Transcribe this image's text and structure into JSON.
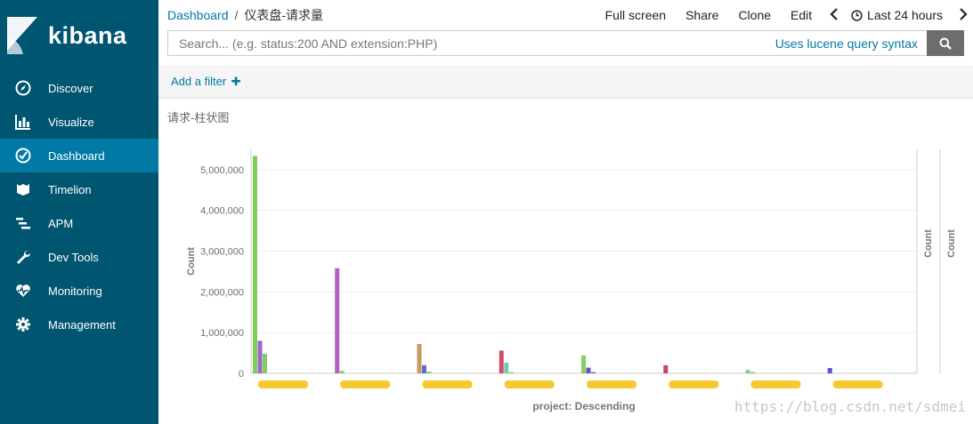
{
  "app": {
    "logo_text": "kibana"
  },
  "sidebar": {
    "items": [
      {
        "label": "Discover",
        "icon": "compass-icon"
      },
      {
        "label": "Visualize",
        "icon": "bar-chart-icon"
      },
      {
        "label": "Dashboard",
        "icon": "dashboard-icon",
        "active": true
      },
      {
        "label": "Timelion",
        "icon": "timelion-icon"
      },
      {
        "label": "APM",
        "icon": "apm-icon"
      },
      {
        "label": "Dev Tools",
        "icon": "wrench-icon"
      },
      {
        "label": "Monitoring",
        "icon": "heartbeat-icon"
      },
      {
        "label": "Management",
        "icon": "gear-icon"
      }
    ]
  },
  "header": {
    "breadcrumb_root": "Dashboard",
    "breadcrumb_sep": "/",
    "breadcrumb_current": "仪表盘-请求量",
    "actions": [
      "Full screen",
      "Share",
      "Clone",
      "Edit"
    ],
    "time_label": "Last 24 hours"
  },
  "search": {
    "placeholder": "Search... (e.g. status:200 AND extension:PHP)",
    "lucene_link": "Uses lucene query syntax"
  },
  "filters": {
    "add_label": "Add a filter"
  },
  "panel": {
    "title": "请求-柱状图"
  },
  "colors": {
    "sidebar": "#005571",
    "active": "#0079a5",
    "link": "#0079a5"
  },
  "chart_data": {
    "type": "bar",
    "ylabel": "Count",
    "xlabel": "project: Descending",
    "ylim": [
      0,
      5500000
    ],
    "yticks": [
      0,
      1000000,
      2000000,
      3000000,
      4000000,
      5000000
    ],
    "ytick_labels": [
      "0",
      "1,000,000",
      "2,000,000",
      "3,000,000",
      "4,000,000",
      "5,000,000"
    ],
    "right_axis_labels": [
      "Count",
      "Count"
    ],
    "grid": true,
    "groups": [
      {
        "bars": [
          {
            "value": 5340000,
            "color": "#7fce5d"
          },
          {
            "value": 800000,
            "color": "#9e65c9"
          },
          {
            "value": 480000,
            "color": "#7fce5d"
          }
        ]
      },
      {
        "bars": [
          {
            "value": 2580000,
            "color": "#b45fc2"
          },
          {
            "value": 60000,
            "color": "#7fce5d"
          }
        ]
      },
      {
        "bars": [
          {
            "value": 720000,
            "color": "#c59b62"
          },
          {
            "value": 200000,
            "color": "#5a6fd0"
          },
          {
            "value": 40000,
            "color": "#7fce5d"
          }
        ]
      },
      {
        "bars": [
          {
            "value": 560000,
            "color": "#d14d6a"
          },
          {
            "value": 260000,
            "color": "#6ccdb6"
          },
          {
            "value": 30000,
            "color": "#7fce5d"
          }
        ]
      },
      {
        "bars": [
          {
            "value": 440000,
            "color": "#86d15f"
          },
          {
            "value": 140000,
            "color": "#6a4fc7"
          },
          {
            "value": 30000,
            "color": "#5a6fd0"
          }
        ]
      },
      {
        "bars": [
          {
            "value": 200000,
            "color": "#c4466a"
          }
        ]
      },
      {
        "bars": [
          {
            "value": 80000,
            "color": "#6fce8a"
          },
          {
            "value": 30000,
            "color": "#7fce5d"
          }
        ]
      },
      {
        "bars": [
          {
            "value": 130000,
            "color": "#5b50d6"
          }
        ]
      }
    ]
  },
  "watermark": "https://blog.csdn.net/sdmei"
}
